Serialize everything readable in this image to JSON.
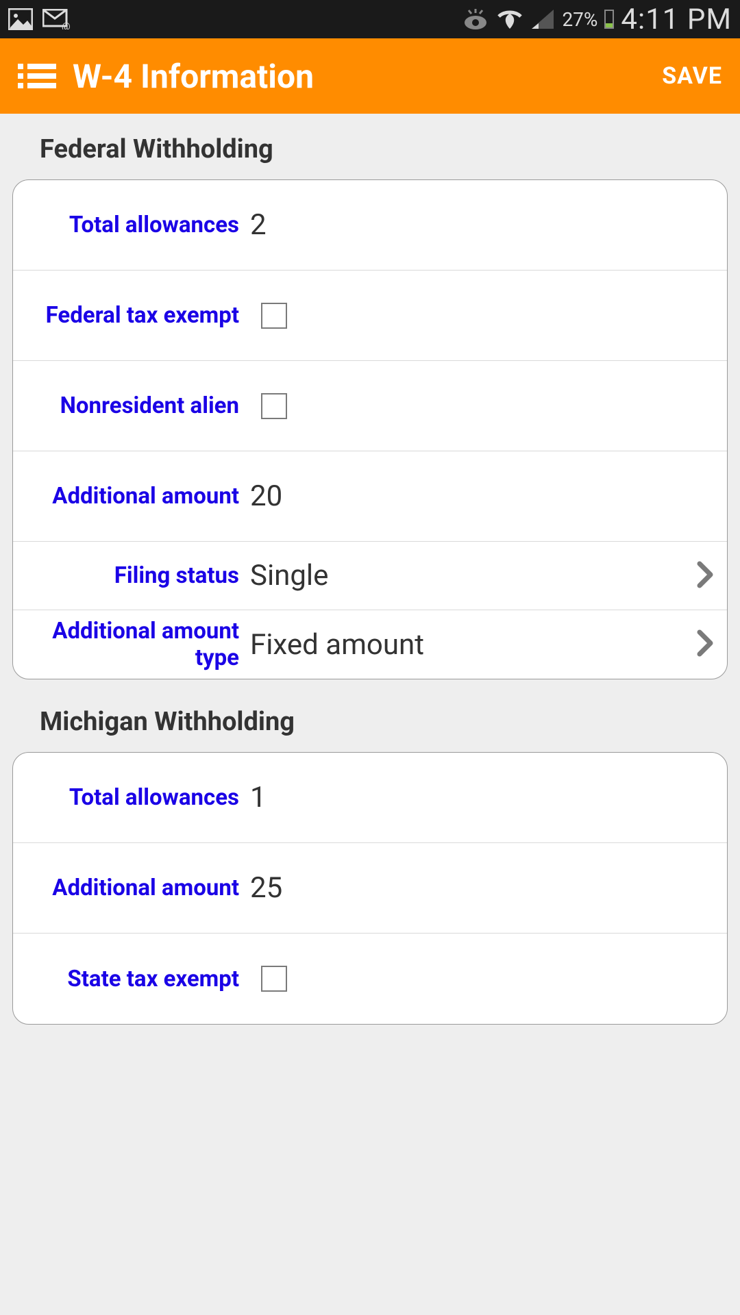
{
  "status": {
    "battery_pct": "27%",
    "time": "4:11 PM"
  },
  "appbar": {
    "title": "W-4 Information",
    "save": "SAVE"
  },
  "sections": [
    {
      "title": "Federal Withholding",
      "rows": {
        "total_allowances": {
          "label": "Total allowances",
          "value": "2"
        },
        "federal_tax_exempt": {
          "label": "Federal tax exempt"
        },
        "nonresident_alien": {
          "label": "Nonresident alien"
        },
        "additional_amount": {
          "label": "Additional amount",
          "value": "20"
        },
        "filing_status": {
          "label": "Filing status",
          "value": "Single"
        },
        "additional_amount_type": {
          "label": "Additional amount type",
          "value": "Fixed amount"
        }
      }
    },
    {
      "title": "Michigan Withholding",
      "rows": {
        "total_allowances": {
          "label": "Total allowances",
          "value": "1"
        },
        "additional_amount": {
          "label": "Additional amount",
          "value": "25"
        },
        "state_tax_exempt": {
          "label": "State tax exempt"
        }
      }
    }
  ]
}
